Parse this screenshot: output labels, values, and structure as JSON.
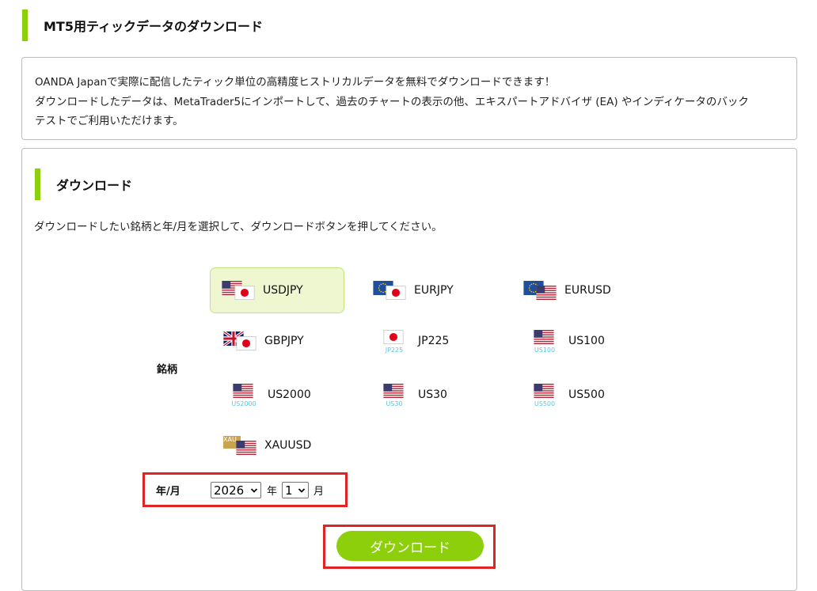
{
  "page_title": "MT5用ティックデータのダウンロード",
  "intro": {
    "line1": "OANDA Japanで実際に配信したティック単位の高精度ヒストリカルデータを無料でダウンロードできます！",
    "line2": "ダウンロードしたデータは、MetaTrader5にインポートして、過去のチャートの表示の他、エキスパートアドバイザ (EA) やインディケータのバック",
    "line3": "テストでご利用いただけます。"
  },
  "download_section": {
    "title": "ダウンロード",
    "instruction": "ダウンロードしたい銘柄と年/月を選択して、ダウンロードボタンを押してください。",
    "symbol_label": "銘柄",
    "symbols": [
      {
        "label": "USDJPY",
        "icon": "us-jp-flags-icon",
        "selected": true
      },
      {
        "label": "EURJPY",
        "icon": "eu-jp-flags-icon"
      },
      {
        "label": "EURUSD",
        "icon": "eu-us-flags-icon"
      },
      {
        "label": "GBPJPY",
        "icon": "gb-jp-flags-icon"
      },
      {
        "label": "JP225",
        "icon": "jp-flag-icon",
        "caption": "JP225"
      },
      {
        "label": "US100",
        "icon": "us-flag-icon",
        "caption": "US100"
      },
      {
        "label": "US2000",
        "icon": "us-flag-icon",
        "caption": "US2000"
      },
      {
        "label": "US30",
        "icon": "us-flag-icon",
        "caption": "US30"
      },
      {
        "label": "US500",
        "icon": "us-flag-icon",
        "caption": "US500"
      },
      {
        "label": "XAUUSD",
        "icon": "gold-us-icon",
        "badge": "XAU"
      }
    ],
    "date_label": "年/月",
    "year_value": "2026",
    "year_unit": "年",
    "month_value": "1",
    "month_unit": "月",
    "download_button": "ダウンロード"
  },
  "colors": {
    "accent": "#8ccf0a",
    "highlight": "#e02424",
    "selected_bg": "#eef7d0",
    "caption": "#5bc4e0"
  }
}
